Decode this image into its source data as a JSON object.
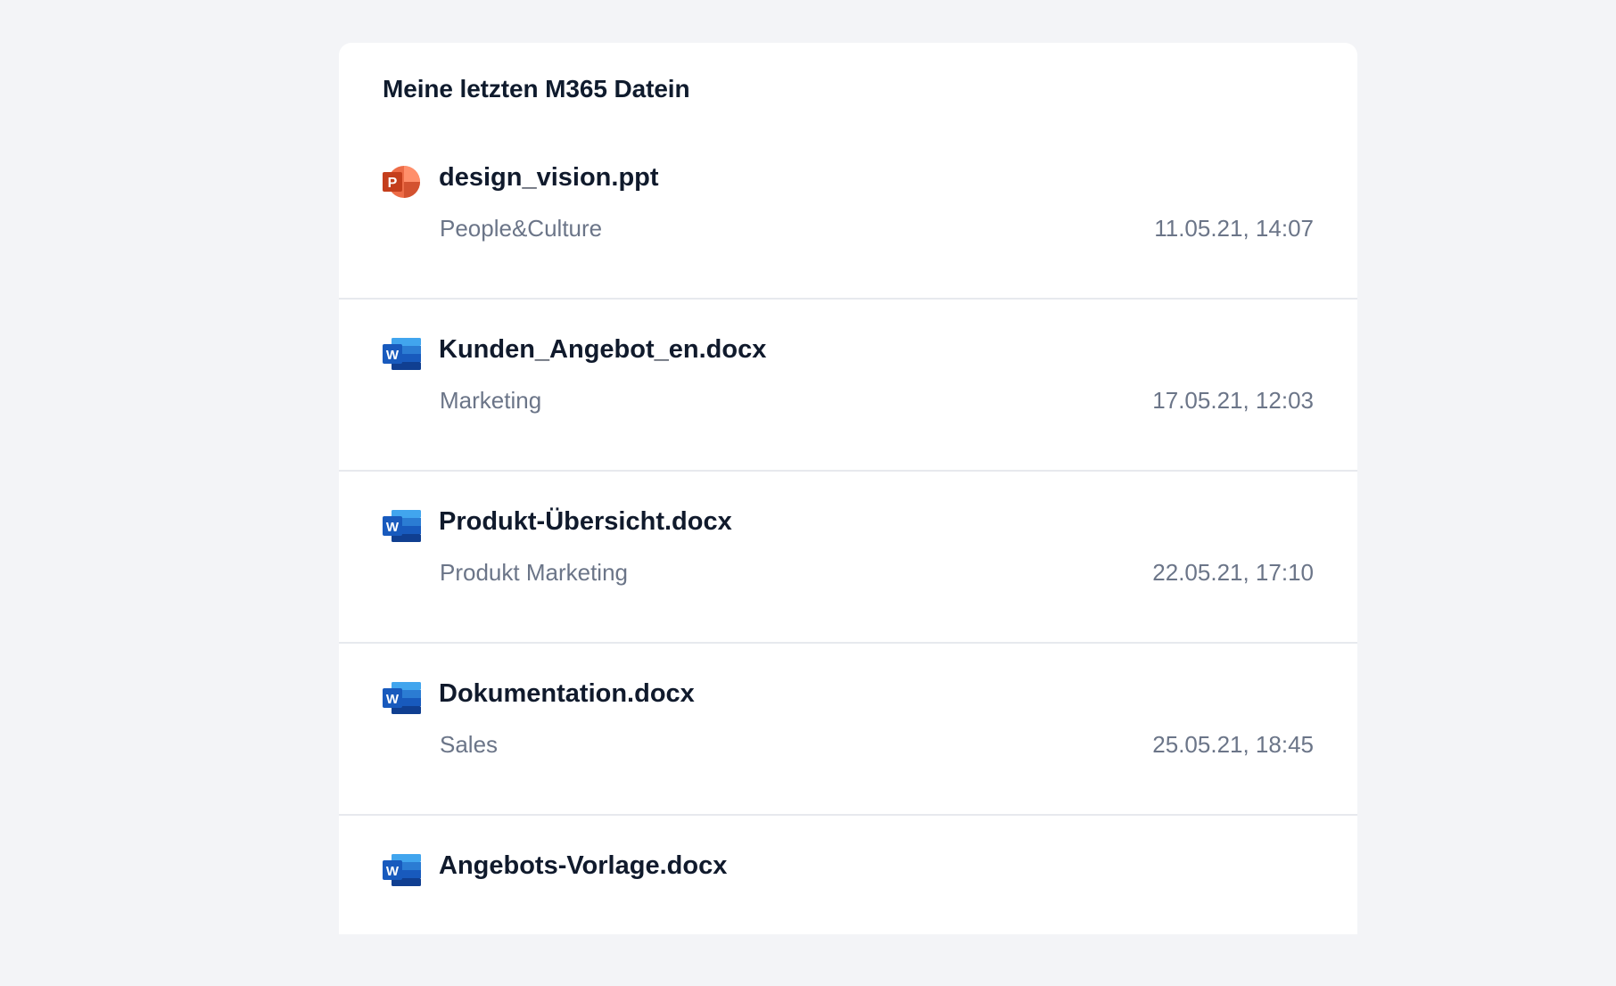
{
  "widget": {
    "title": "Meine letzten M365 Datein"
  },
  "files": [
    {
      "name": "design_vision.ppt",
      "folder": "People&Culture",
      "date": "11.05.21, 14:07",
      "icon": "powerpoint-icon"
    },
    {
      "name": "Kunden_Angebot_en.docx",
      "folder": "Marketing",
      "date": "17.05.21, 12:03",
      "icon": "word-icon"
    },
    {
      "name": "Produkt-Übersicht.docx",
      "folder": "Produkt Marketing",
      "date": "22.05.21, 17:10",
      "icon": "word-icon"
    },
    {
      "name": "Dokumentation.docx",
      "folder": "Sales",
      "date": "25.05.21, 18:45",
      "icon": "word-icon"
    },
    {
      "name": "Angebots-Vorlage.docx",
      "folder": "",
      "date": "",
      "icon": "word-icon"
    }
  ],
  "colors": {
    "background": "#f3f4f7",
    "card": "#ffffff",
    "powerpoint": "#d35230",
    "word": "#185abd"
  }
}
